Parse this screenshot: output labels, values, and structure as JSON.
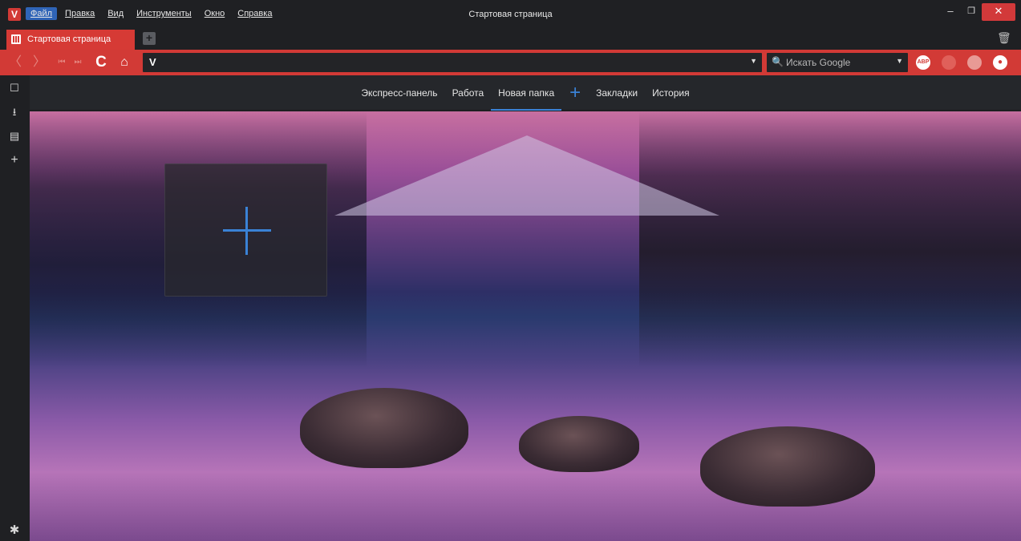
{
  "window": {
    "title": "Стартовая страница",
    "logo": "V",
    "minimize_glyph": "–",
    "maximize_glyph": "❐",
    "close_glyph": "✕"
  },
  "menu": [
    "Файл",
    "Правка",
    "Вид",
    "Инструменты",
    "Окно",
    "Справка"
  ],
  "tabs": [
    {
      "label": "Стартовая страница",
      "active": true
    }
  ],
  "tabstrip": {
    "new_tab_glyph": "+",
    "trash_glyph": "🗑"
  },
  "toolbar": {
    "back_glyph": "〈",
    "forward_glyph": "〉",
    "first_glyph": "⏮",
    "last_glyph": "⏭",
    "reload_glyph": "C",
    "home_glyph": "⌂",
    "address": {
      "brand": "V",
      "value": "",
      "dropdown_glyph": "▼"
    },
    "search": {
      "icon_glyph": "🔍",
      "placeholder": "Искать Google",
      "dropdown_glyph": "▼"
    },
    "extensions": [
      {
        "name": "adblock-plus",
        "label": "ABP"
      },
      {
        "name": "blocker",
        "label": ""
      },
      {
        "name": "globe",
        "label": ""
      },
      {
        "name": "chat",
        "label": ""
      }
    ]
  },
  "side_panel": {
    "bookmarks_glyph": "☐",
    "downloads_glyph": "⭳",
    "notes_glyph": "▤",
    "add_glyph": "+",
    "settings_glyph": "✱"
  },
  "speed_dial": {
    "nav": [
      {
        "label": "Экспресс-панель",
        "active": false
      },
      {
        "label": "Работа",
        "active": false
      },
      {
        "label": "Новая папка",
        "active": true
      },
      {
        "label": "Закладки",
        "active": false
      },
      {
        "label": "История",
        "active": false
      }
    ],
    "add_folder_glyph": "+"
  },
  "colors": {
    "accent_red": "#d23a36",
    "accent_blue": "#3a82d6",
    "chrome_dark": "#1f2023"
  }
}
